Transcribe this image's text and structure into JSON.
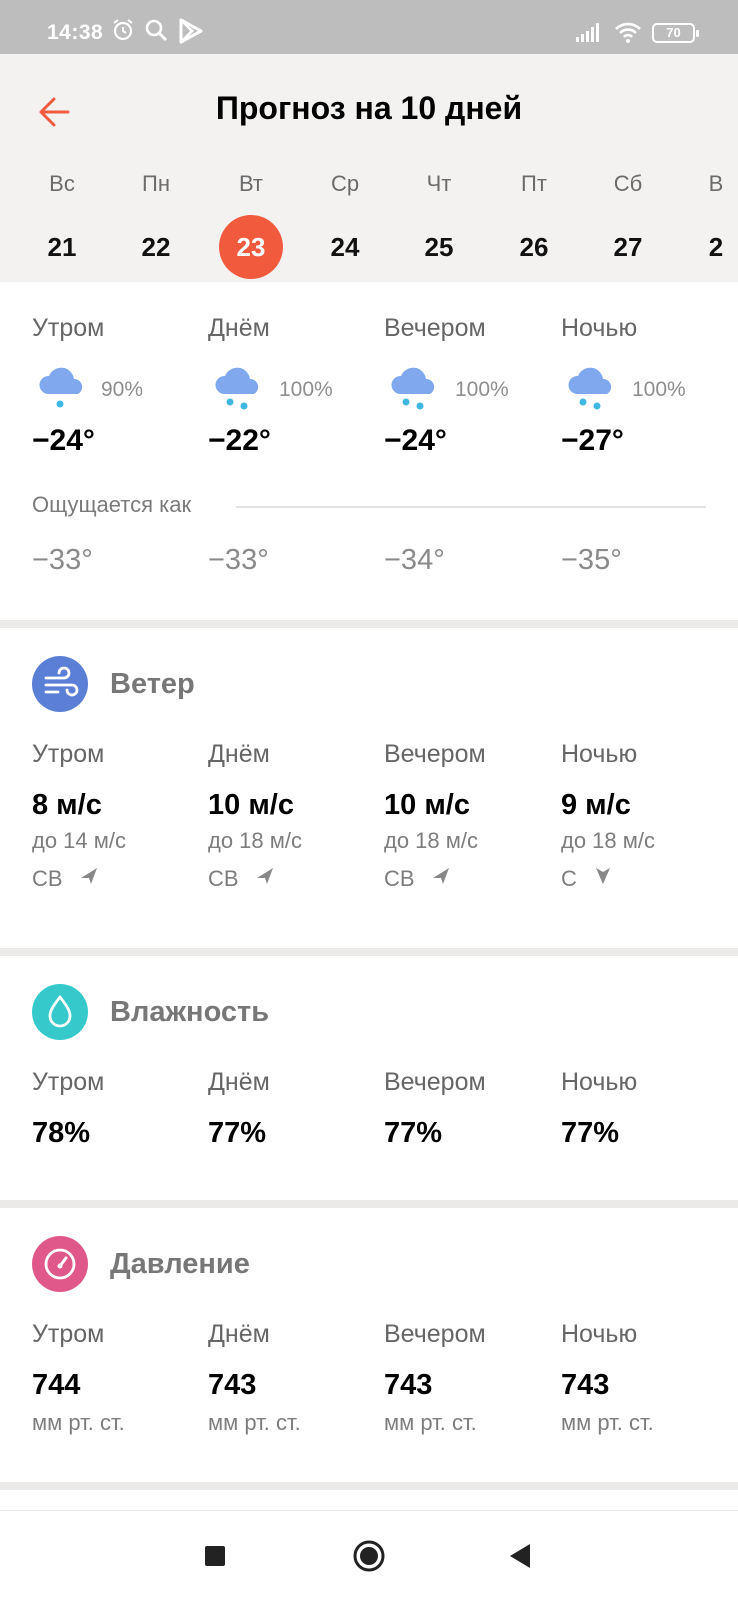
{
  "status_bar": {
    "time": "14:38",
    "battery": "70"
  },
  "header": {
    "title": "Прогноз на 10 дней",
    "days": [
      {
        "dow": "Вс",
        "num": "21"
      },
      {
        "dow": "Пн",
        "num": "22"
      },
      {
        "dow": "Вт",
        "num": "23",
        "selected": true
      },
      {
        "dow": "Ср",
        "num": "24"
      },
      {
        "dow": "Чт",
        "num": "25"
      },
      {
        "dow": "Пт",
        "num": "26"
      },
      {
        "dow": "Сб",
        "num": "27"
      },
      {
        "dow": "В",
        "num": "2"
      }
    ]
  },
  "periods": [
    "Утром",
    "Днём",
    "Вечером",
    "Ночью"
  ],
  "forecast": {
    "items": [
      {
        "icon": "cloud-snow-icon",
        "prob": "90%",
        "temp": "−24°",
        "feels": "−33°"
      },
      {
        "icon": "cloud-heavy-snow-icon",
        "prob": "100%",
        "temp": "−22°",
        "feels": "−33°"
      },
      {
        "icon": "cloud-heavy-snow-icon",
        "prob": "100%",
        "temp": "−24°",
        "feels": "−34°"
      },
      {
        "icon": "cloud-heavy-snow-icon",
        "prob": "100%",
        "temp": "−27°",
        "feels": "−35°"
      }
    ],
    "feels_label": "Ощущается как"
  },
  "wind": {
    "title": "Ветер",
    "icon": "wind-icon",
    "items": [
      {
        "speed": "8 м/с",
        "gust": "до 14 м/с",
        "dir": "СВ"
      },
      {
        "speed": "10 м/с",
        "gust": "до 18 м/с",
        "dir": "СВ"
      },
      {
        "speed": "10 м/с",
        "gust": "до 18 м/с",
        "dir": "СВ"
      },
      {
        "speed": "9 м/с",
        "gust": "до 18 м/с",
        "dir": "С"
      }
    ]
  },
  "humidity": {
    "title": "Влажность",
    "icon": "droplet-icon",
    "items": [
      "78%",
      "77%",
      "77%",
      "77%"
    ]
  },
  "pressure": {
    "title": "Давление",
    "icon": "gauge-icon",
    "items": [
      "744",
      "743",
      "743",
      "743"
    ],
    "unit": "мм рт. ст."
  },
  "colors": {
    "accent": "#f25a3e",
    "wind_icon": "#5b7fd6",
    "humidity_icon": "#35c9cc",
    "pressure_icon": "#e0578a",
    "snow": "#3fb7e0"
  }
}
